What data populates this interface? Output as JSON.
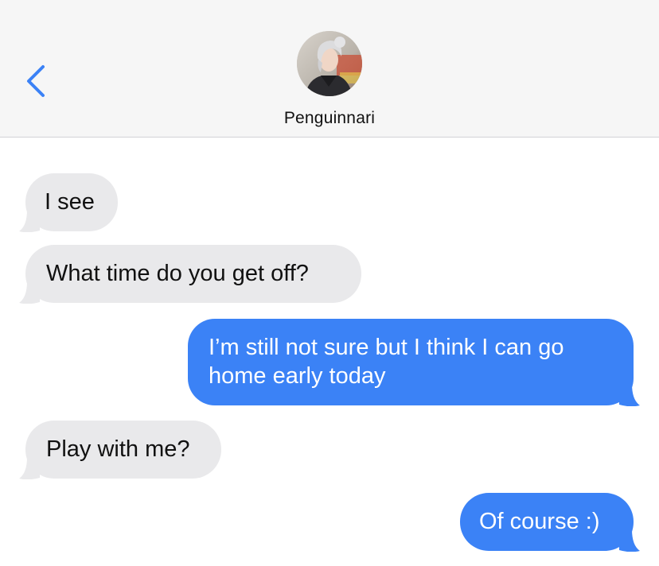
{
  "header": {
    "back_icon": "chevron-left-icon",
    "contact_name": "Penguinnari",
    "accent_color": "#3b82f6"
  },
  "messages": [
    {
      "direction": "incoming",
      "text": "I see"
    },
    {
      "direction": "incoming",
      "text": "What time do you get off?"
    },
    {
      "direction": "outgoing",
      "line1": "I’m still not sure but I think I can go",
      "line2": "home early today"
    },
    {
      "direction": "incoming",
      "text": "Play with me?"
    },
    {
      "direction": "outgoing",
      "text": "Of course :)"
    }
  ],
  "colors": {
    "incoming_bubble": "#e9e9eb",
    "outgoing_bubble": "#3b82f6",
    "header_background": "#f6f6f6"
  }
}
